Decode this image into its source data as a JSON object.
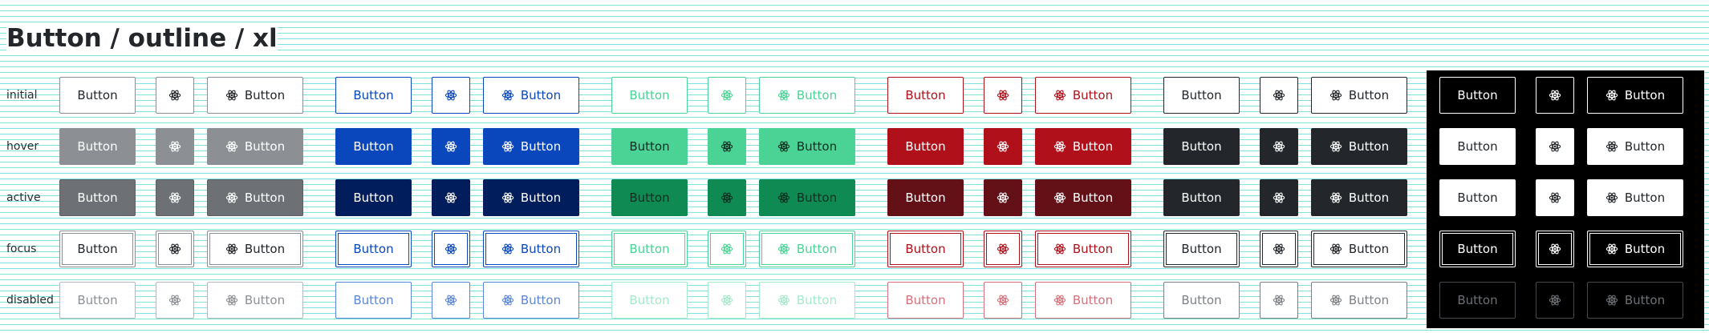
{
  "title": "Button / outline / xl",
  "button_label": "Button",
  "icon": "atom-icon",
  "states": [
    "initial",
    "hover",
    "active",
    "focus",
    "disabled"
  ],
  "variants": [
    {
      "name": "neutral",
      "styles": [
        {
          "bg": "#ffffff",
          "fg": "#23272b",
          "bd": "#8c9094"
        },
        {
          "bg": "#8c9094",
          "fg": "#ffffff",
          "bd": "#8c9094"
        },
        {
          "bg": "#6d7175",
          "fg": "#ffffff",
          "bd": "#5c6064"
        },
        {
          "bg": "#ffffff",
          "fg": "#23272b",
          "bd": "#8c9094",
          "ring": true
        },
        {
          "bg": "#ffffff",
          "fg": "#8c9094",
          "bd": "#b5b9bd"
        }
      ]
    },
    {
      "name": "primary",
      "styles": [
        {
          "bg": "#ffffff",
          "fg": "#0a47bd",
          "bd": "#0a47bd"
        },
        {
          "bg": "#0a47bd",
          "fg": "#ffffff",
          "bd": "#0a47bd"
        },
        {
          "bg": "#021d5c",
          "fg": "#ffffff",
          "bd": "#021d5c"
        },
        {
          "bg": "#ffffff",
          "fg": "#0a47bd",
          "bd": "#0a47bd",
          "ring": true
        },
        {
          "bg": "#ffffff",
          "fg": "#5b86d6",
          "bd": "#5b86d6"
        }
      ]
    },
    {
      "name": "success",
      "styles": [
        {
          "bg": "#ffffff",
          "fg": "#49d394",
          "bd": "#49d394"
        },
        {
          "bg": "#4ad395",
          "fg": "#0f2f22",
          "bd": "#4ad395"
        },
        {
          "bg": "#0e8a52",
          "fg": "#0f2f22",
          "bd": "#0e8a52"
        },
        {
          "bg": "#ffffff",
          "fg": "#49d394",
          "bd": "#49d394",
          "ring": true
        },
        {
          "bg": "#ffffff",
          "fg": "#a4e9c9",
          "bd": "#a4e9c9"
        }
      ]
    },
    {
      "name": "danger",
      "styles": [
        {
          "bg": "#ffffff",
          "fg": "#b01019",
          "bd": "#b01019"
        },
        {
          "bg": "#b01019",
          "fg": "#ffffff",
          "bd": "#b01019"
        },
        {
          "bg": "#631016",
          "fg": "#ffffff",
          "bd": "#631016"
        },
        {
          "bg": "#ffffff",
          "fg": "#b01019",
          "bd": "#b01019",
          "ring": true
        },
        {
          "bg": "#ffffff",
          "fg": "#d5707a",
          "bd": "#d5707a"
        }
      ]
    },
    {
      "name": "dark",
      "styles": [
        {
          "bg": "#ffffff",
          "fg": "#23272b",
          "bd": "#23272b"
        },
        {
          "bg": "#23272b",
          "fg": "#ffffff",
          "bd": "#23272b"
        },
        {
          "bg": "#23272b",
          "fg": "#ffffff",
          "bd": "#23272b"
        },
        {
          "bg": "#ffffff",
          "fg": "#23272b",
          "bd": "#23272b",
          "ring": true
        },
        {
          "bg": "#ffffff",
          "fg": "#7d8185",
          "bd": "#7d8185"
        }
      ]
    },
    {
      "name": "light",
      "styles": [
        {
          "bg": "#000000",
          "fg": "#ffffff",
          "bd": "#ffffff"
        },
        {
          "bg": "#ffffff",
          "fg": "#23272b",
          "bd": "#ffffff"
        },
        {
          "bg": "#ffffff",
          "fg": "#23272b",
          "bd": "#ffffff"
        },
        {
          "bg": "#000000",
          "fg": "#ffffff",
          "bd": "#ffffff",
          "ring": true
        },
        {
          "bg": "#000000",
          "fg": "#6d7175",
          "bd": "#44484c"
        }
      ]
    }
  ]
}
